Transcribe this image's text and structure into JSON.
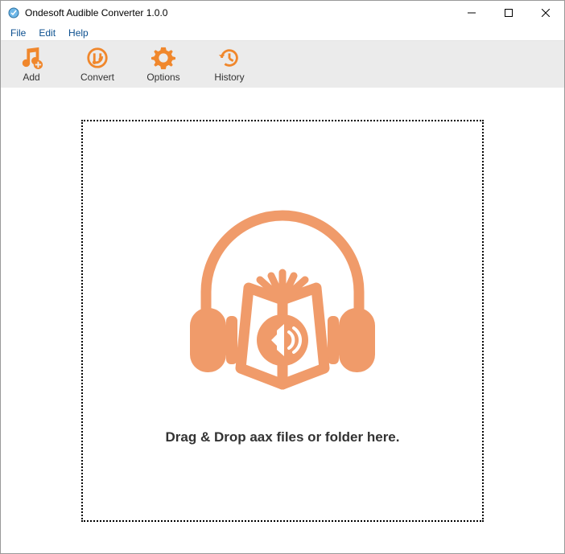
{
  "window": {
    "title": "Ondesoft Audible Converter 1.0.0"
  },
  "menubar": {
    "items": [
      "File",
      "Edit",
      "Help"
    ]
  },
  "toolbar": {
    "add": "Add",
    "convert": "Convert",
    "options": "Options",
    "history": "History"
  },
  "dropzone": {
    "text": "Drag & Drop aax files or folder here."
  },
  "colors": {
    "accent": "#f0872c",
    "illustration": "#f09b6a"
  }
}
